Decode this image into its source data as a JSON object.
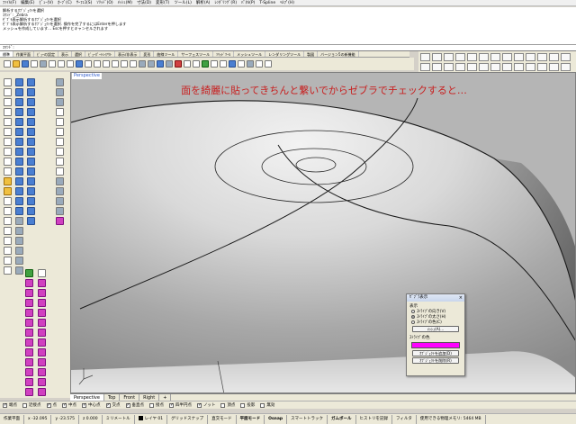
{
  "menu": [
    "ﾌｧｲﾙ(F)",
    "編集(E)",
    "ﾋﾞｭｰ(V)",
    "ｶｰﾌﾞ(C)",
    "ｻｰﾌｪｽ(S)",
    "ｿﾘｯﾄﾞ(O)",
    "ﾒｯｼｭ(M)",
    "寸法(D)",
    "変形(T)",
    "ツール(L)",
    "解析(A)",
    "ﾚﾝﾀﾞﾘﾝｸﾞ(R)",
    "ﾊﾟﾈﾙ(P)",
    "T-Spline",
    "ﾍﾙﾌﾟ(H)"
  ],
  "history": [
    "解析するｵﾌﾞｼﾞｪｸﾄを選択",
    "ｺﾏﾝﾄﾞ: _Zebra",
    "ｾﾞﾌﾞﾗ表示解析するｵﾌﾞｼﾞｪｸﾄを選択",
    "ｾﾞﾌﾞﾗ表示解析するｵﾌﾞｼﾞｪｸﾄを選択. 操作を完了するにはEnterを押します",
    "メッシュを作成しています... Escを押すとキャンセルされます"
  ],
  "cmdline": "ｺﾏﾝﾄﾞ:",
  "tabs": [
    "標準",
    "作業平面",
    "ﾋﾞｭｰの設定",
    "表示",
    "選択",
    "ﾋﾞｭｰﾎﾟｰﾄﾚｲｱｳﾄ",
    "表示/非表示",
    "変形",
    "曲線ツール",
    "サーフェスツール",
    "ｿﾘｯﾄﾞﾂｰﾙ",
    "メッシュツール",
    "レンダリングツール",
    "製図",
    "バージョン5の新機能"
  ],
  "active_tab": "標準",
  "viewport": {
    "label": "Perspective",
    "caption": "面を綺麗に貼ってきちんと繋いでからゼブラでチェックすると…"
  },
  "viewtabs": [
    "Perspective",
    "Top",
    "Front",
    "Right"
  ],
  "viewtab_add": "+",
  "active_viewtab": "Perspective",
  "osnap": [
    {
      "label": "端点",
      "on": true
    },
    {
      "label": "近接点",
      "on": false
    },
    {
      "label": "点",
      "on": true
    },
    {
      "label": "中点",
      "on": true
    },
    {
      "label": "中心点",
      "on": true
    },
    {
      "label": "交点",
      "on": true
    },
    {
      "label": "垂直点",
      "on": true
    },
    {
      "label": "接点",
      "on": false
    },
    {
      "label": "四半円点",
      "on": true
    },
    {
      "label": "ノット",
      "on": true
    },
    {
      "label": "頂点",
      "on": false
    },
    {
      "label": "投影",
      "on": false
    },
    {
      "label": "無効",
      "on": false
    }
  ],
  "status": {
    "cplane": "作業平面",
    "x": "x -32.095",
    "y": "y -23.575",
    "z": "z 0.000",
    "units": "ミリメートル",
    "layer": "レイヤ 01",
    "grid_snap": "グリッドスナップ",
    "ortho": "直交モード",
    "planar": "平面モード",
    "osnap": "Osnap",
    "smarttrack": "スマートトラック",
    "gumball": "ガムボール",
    "history": "ヒストリを記録",
    "filter": "フィルタ",
    "memory": "使用できる物理メモリ: 5464 MB"
  },
  "dialog": {
    "title": "ｾﾞﾌﾞﾗ表示",
    "close": "×",
    "display_label": "表示",
    "options": [
      {
        "label": "ｽﾄﾗｲﾌﾟの向き(V)",
        "on": false
      },
      {
        "label": "ｽﾄﾗｲﾌﾟの太さ(H)",
        "on": true
      },
      {
        "label": "ｽﾄﾗｲﾌﾟの色(C)",
        "on": false
      }
    ],
    "mesh_button": "ﾒｯｼｭ(A)...",
    "color_label": "ｽﾄﾗｲﾌﾟの色",
    "stripe_color": "#ff00ff",
    "add_button": "ｵﾌﾞｼﾞｪｸﾄを追加(D)",
    "remove_button": "ｵﾌﾞｼﾞｪｸﾄを削除(R)"
  },
  "colors": {
    "caption": "#c82020",
    "viewport_bg": "#b3b3b3",
    "surface_light": "#e6e6e6",
    "surface_dark": "#7a7a7a"
  }
}
